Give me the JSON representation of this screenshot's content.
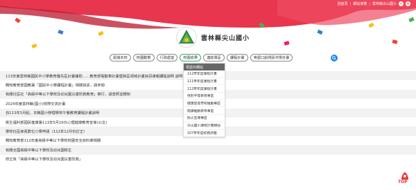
{
  "topbar": {
    "links": [
      "回首頁",
      "網站導覽",
      "雲林縣尖山國小"
    ],
    "font_small": "A",
    "font_large": "A"
  },
  "school": {
    "name": "雲林縣尖山國小",
    "logo_icon": "school-logo-icon"
  },
  "nav": {
    "items": [
      "認識本校",
      "校園動態",
      "行政處室",
      "校園成果",
      "連結專區",
      "課程計畫",
      "英語口說視訊共學計畫"
    ],
    "active_index": 3
  },
  "dropdown": {
    "header": "母語日網站",
    "items": [
      "112學年度課程計畫",
      "111學年度課程計畫",
      "112學年度課程計畫",
      "性別平等教育專區",
      "健康促進學校推動專區",
      "閱讀推動教育專區",
      "防火宣導專區",
      "尖山國小課程計畫網站",
      "107學年度校務評鑑"
    ]
  },
  "news": [
    "113年度雲林縣國民中小學教育優先區計畫補助……教育部電動車計畫暨跨區領域計畫資訊通報課程說明 說明如附件",
    "轉知教育部國教署「國民中小學課程計畫」相關資訊，請參閱",
    "有關社區社「高級中等以下學校及幼兒園災害防救教育」推行，請查照並轉知",
    "2024年度雲林縣(國小)校際交流計畫",
    "自113年5月起，本縣國小辦理學校午餐教育課程計畫說明",
    "衛生福利部國民健康署113年5月16日心理健康教育宣導(公文)",
    "學校社區家長數位小學申請（112年12月份訂正）",
    "轉知教育部112年度高級中等以下學校校園安全資料庫相關",
    "有關全國高級中等以下學校及幼兒園衛生",
    "修正後「高級中等以下學校及幼兒園災害防救」"
  ],
  "top_button": {
    "label": "TOP"
  }
}
